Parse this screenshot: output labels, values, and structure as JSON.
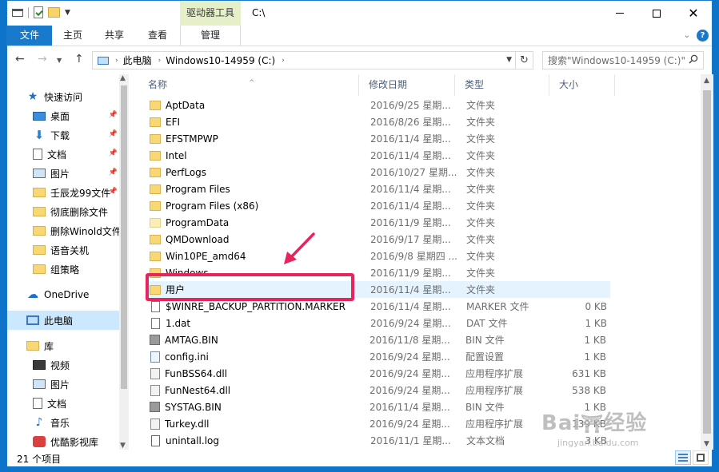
{
  "titlebar": {
    "context_tab": "驱动器工具",
    "path": "C:\\"
  },
  "ribbon": {
    "tabs": [
      "文件",
      "主页",
      "共享",
      "查看",
      "管理"
    ]
  },
  "address": {
    "segments": [
      "此电脑",
      "Windows10-14959 (C:)"
    ]
  },
  "search": {
    "placeholder": "搜索\"Windows10-14959 (C:)\""
  },
  "navpane": {
    "items": [
      {
        "label": "快速访问",
        "icon": "star-icon"
      },
      {
        "label": "桌面",
        "icon": "desktop-icon",
        "pinned": true
      },
      {
        "label": "下载",
        "icon": "download-icon",
        "pinned": true
      },
      {
        "label": "文档",
        "icon": "document-icon",
        "pinned": true
      },
      {
        "label": "图片",
        "icon": "picture-icon",
        "pinned": true
      },
      {
        "label": "壬辰龙99文件",
        "icon": "folder-icon",
        "pinned": true
      },
      {
        "label": "彻底删除文件",
        "icon": "folder-icon"
      },
      {
        "label": "删除Winold文件",
        "icon": "folder-icon"
      },
      {
        "label": "语音关机",
        "icon": "folder-icon"
      },
      {
        "label": "组策略",
        "icon": "folder-icon"
      },
      {
        "label": "OneDrive",
        "icon": "cloud-icon"
      },
      {
        "label": "此电脑",
        "icon": "pc-icon",
        "selected": true
      },
      {
        "label": "库",
        "icon": "library-icon"
      },
      {
        "label": "视频",
        "icon": "video-icon"
      },
      {
        "label": "图片",
        "icon": "picture-icon"
      },
      {
        "label": "文档",
        "icon": "document-icon"
      },
      {
        "label": "音乐",
        "icon": "music-icon"
      },
      {
        "label": "优酷影视库",
        "icon": "media-icon"
      }
    ]
  },
  "columns": {
    "name": "名称",
    "date": "修改日期",
    "type": "类型",
    "size": "大小"
  },
  "files": [
    {
      "name": "AptData",
      "date": "2016/9/25 星期...",
      "type": "文件夹",
      "size": "",
      "icon": "folder"
    },
    {
      "name": "EFI",
      "date": "2016/8/26 星期...",
      "type": "文件夹",
      "size": "",
      "icon": "folder"
    },
    {
      "name": "EFSTMPWP",
      "date": "2016/11/4 星期...",
      "type": "文件夹",
      "size": "",
      "icon": "folder"
    },
    {
      "name": "Intel",
      "date": "2016/11/4 星期...",
      "type": "文件夹",
      "size": "",
      "icon": "folder"
    },
    {
      "name": "PerfLogs",
      "date": "2016/10/27 星期...",
      "type": "文件夹",
      "size": "",
      "icon": "folder"
    },
    {
      "name": "Program Files",
      "date": "2016/11/4 星期...",
      "type": "文件夹",
      "size": "",
      "icon": "folder"
    },
    {
      "name": "Program Files (x86)",
      "date": "2016/11/4 星期...",
      "type": "文件夹",
      "size": "",
      "icon": "folder"
    },
    {
      "name": "ProgramData",
      "date": "2016/11/9 星期...",
      "type": "文件夹",
      "size": "",
      "icon": "folder-light"
    },
    {
      "name": "QMDownload",
      "date": "2016/9/17 星期...",
      "type": "文件夹",
      "size": "",
      "icon": "folder"
    },
    {
      "name": "Win10PE_amd64",
      "date": "2016/9/8 星期四 ...",
      "type": "文件夹",
      "size": "",
      "icon": "folder"
    },
    {
      "name": "Windows",
      "date": "2016/11/9 星期...",
      "type": "文件夹",
      "size": "",
      "icon": "folder"
    },
    {
      "name": "用户",
      "date": "2016/11/4 星期...",
      "type": "文件夹",
      "size": "",
      "icon": "folder",
      "highlighted": true
    },
    {
      "name": "$WINRE_BACKUP_PARTITION.MARKER",
      "date": "2016/11/4 星期...",
      "type": "MARKER 文件",
      "size": "0 KB",
      "icon": "file"
    },
    {
      "name": "1.dat",
      "date": "2016/9/24 星期...",
      "type": "DAT 文件",
      "size": "1 KB",
      "icon": "file"
    },
    {
      "name": "AMTAG.BIN",
      "date": "2016/11/8 星期...",
      "type": "BIN 文件",
      "size": "1 KB",
      "icon": "bin"
    },
    {
      "name": "config.ini",
      "date": "2016/9/24 星期...",
      "type": "配置设置",
      "size": "1 KB",
      "icon": "config"
    },
    {
      "name": "FunBSS64.dll",
      "date": "2016/9/24 星期...",
      "type": "应用程序扩展",
      "size": "631 KB",
      "icon": "dll"
    },
    {
      "name": "FunNest64.dll",
      "date": "2016/9/24 星期...",
      "type": "应用程序扩展",
      "size": "538 KB",
      "icon": "dll"
    },
    {
      "name": "SYSTAG.BIN",
      "date": "2016/11/4 星期...",
      "type": "BIN 文件",
      "size": "1 KB",
      "icon": "bin"
    },
    {
      "name": "Turkey.dll",
      "date": "2016/9/24 星期...",
      "type": "应用程序扩展",
      "size": "139 KB",
      "icon": "dll"
    },
    {
      "name": "unintall.log",
      "date": "2016/11/1 星期...",
      "type": "文本文档",
      "size": "3 KB",
      "icon": "log"
    }
  ],
  "status": {
    "item_count": "21 个项目"
  },
  "colors": {
    "accent": "#1979ca",
    "annotation": "#e8245c",
    "selected_bg": "#cce8ff"
  }
}
